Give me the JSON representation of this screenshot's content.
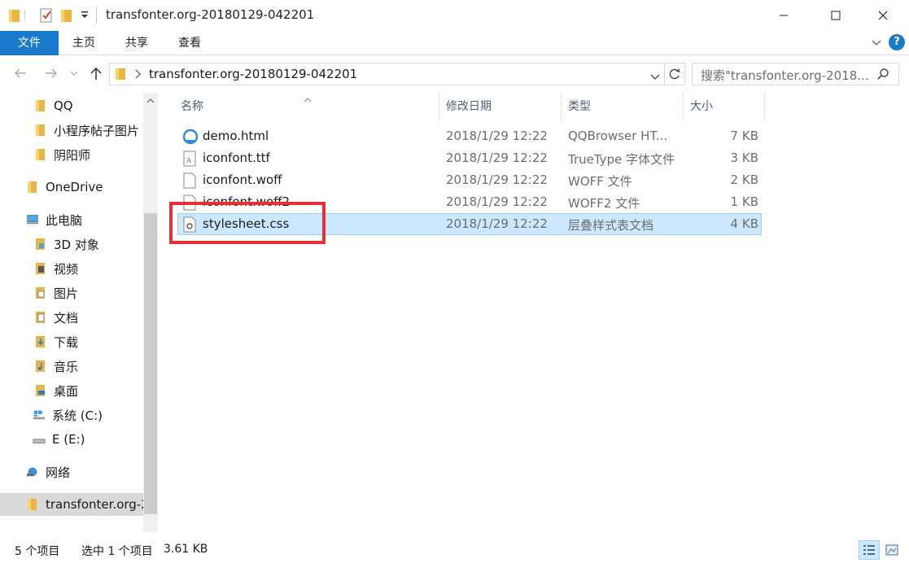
{
  "window": {
    "title": "transfonter.org-20180129-042201",
    "controls": {
      "minimize": "—",
      "maximize": "☐",
      "close": "✕"
    }
  },
  "ribbon": {
    "tabs": [
      "文件",
      "主页",
      "共享",
      "查看"
    ],
    "help": "?"
  },
  "address": {
    "path": "transfonter.org-20180129-042201",
    "search_placeholder": "搜索\"transfonter.org-2018..."
  },
  "navpane": {
    "items": [
      {
        "label": "QQ",
        "icon": "folder-icon"
      },
      {
        "label": "小程序帖子图片",
        "icon": "folder-icon"
      },
      {
        "label": "阴阳师",
        "icon": "folder-icon"
      },
      {
        "label": "OneDrive",
        "icon": "onedrive-folder-icon"
      },
      {
        "label": "此电脑",
        "icon": "computer-icon"
      },
      {
        "label": "3D 对象",
        "icon": "3d-objects-icon"
      },
      {
        "label": "视频",
        "icon": "videos-icon"
      },
      {
        "label": "图片",
        "icon": "pictures-icon"
      },
      {
        "label": "文档",
        "icon": "documents-icon"
      },
      {
        "label": "下载",
        "icon": "downloads-icon"
      },
      {
        "label": "音乐",
        "icon": "music-icon"
      },
      {
        "label": "桌面",
        "icon": "desktop-icon"
      },
      {
        "label": "系统 (C:)",
        "icon": "system-drive-icon"
      },
      {
        "label": "E (E:)",
        "icon": "drive-icon"
      },
      {
        "label": "网络",
        "icon": "network-icon"
      },
      {
        "label": "transfonter.org-2",
        "icon": "folder-icon"
      }
    ]
  },
  "filelist": {
    "columns": [
      "名称",
      "修改日期",
      "类型",
      "大小"
    ],
    "rows": [
      {
        "name": "demo.html",
        "date": "2018/1/29 12:22",
        "type": "QQBrowser HT...",
        "size": "7 KB",
        "icon": "browser-html-icon"
      },
      {
        "name": "iconfont.ttf",
        "date": "2018/1/29 12:22",
        "type": "TrueType 字体文件",
        "size": "3 KB",
        "icon": "font-file-icon"
      },
      {
        "name": "iconfont.woff",
        "date": "2018/1/29 12:22",
        "type": "WOFF 文件",
        "size": "2 KB",
        "icon": "blank-file-icon"
      },
      {
        "name": "iconfont.woff2",
        "date": "2018/1/29 12:22",
        "type": "WOFF2 文件",
        "size": "1 KB",
        "icon": "blank-file-icon"
      },
      {
        "name": "stylesheet.css",
        "date": "2018/1/29 12:22",
        "type": "层叠样式表文档",
        "size": "4 KB",
        "icon": "css-file-icon"
      }
    ]
  },
  "status": {
    "count": "5 个项目",
    "selection": "选中 1 个项目",
    "size": "3.61 KB"
  },
  "colors": {
    "accent": "#1979ca",
    "selection_bg": "#cce8ff",
    "highlight_border": "#e5303a"
  }
}
